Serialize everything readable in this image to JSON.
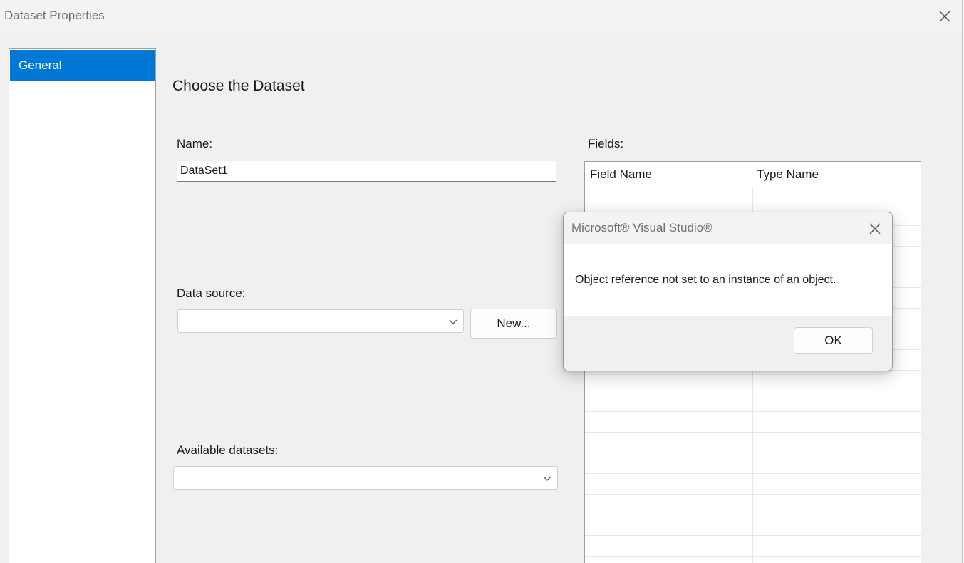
{
  "window": {
    "title": "Dataset Properties"
  },
  "nav": {
    "items": [
      {
        "label": "General",
        "selected": true
      }
    ]
  },
  "main": {
    "heading": "Choose the Dataset",
    "name_label": "Name:",
    "name_value": "DataSet1",
    "data_source_label": "Data source:",
    "data_source_value": "",
    "new_button_label": "New...",
    "available_datasets_label": "Available datasets:",
    "available_datasets_value": ""
  },
  "fields": {
    "label": "Fields:",
    "columns": [
      "Field Name",
      "Type Name"
    ],
    "rows": []
  },
  "dialog": {
    "title": "Microsoft® Visual Studio®",
    "message": "Object reference not set to an instance of an object.",
    "ok_label": "OK"
  },
  "colors": {
    "accent": "#0078d7",
    "window_bg": "#f0f0f0",
    "title_text": "#707070"
  },
  "icons": {
    "close": "close-icon",
    "dropdown": "chevron-down-icon"
  }
}
